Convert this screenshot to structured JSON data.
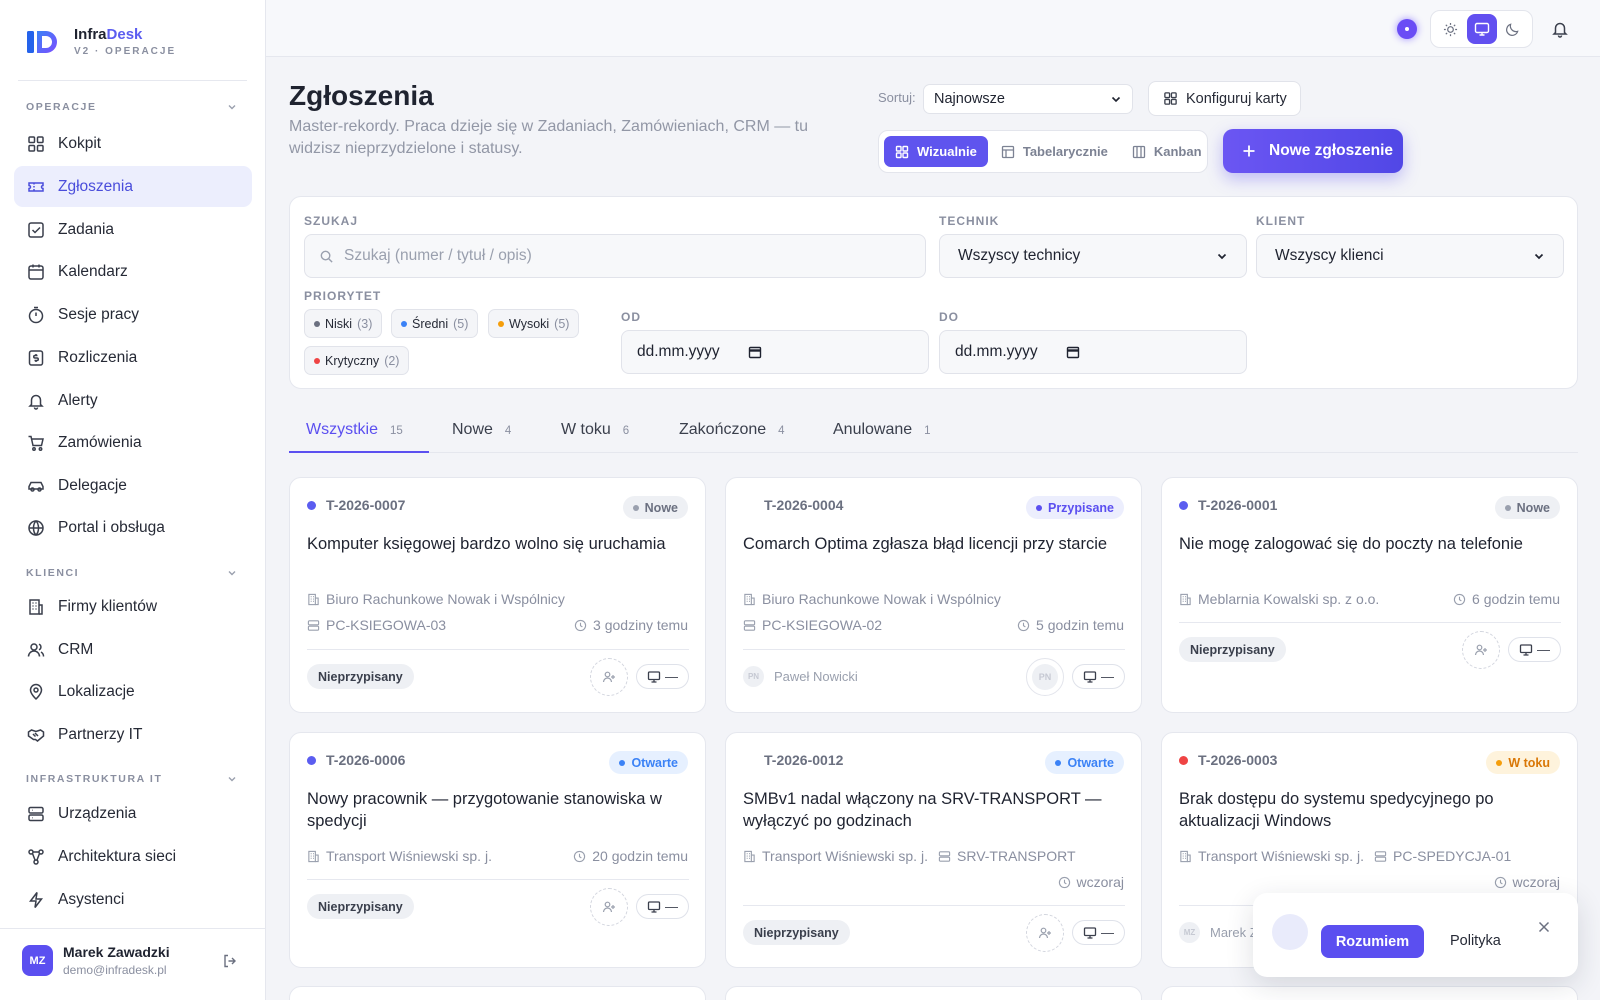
{
  "brand": {
    "name_prefix": "Infra",
    "name_accent": "Desk",
    "subtitle": "V2 · OPERACJE"
  },
  "sidebar": {
    "sections": [
      {
        "title": "OPERACJE"
      },
      {
        "title": "KLIENCI"
      },
      {
        "title": "INFRASTRUKTURA IT"
      }
    ],
    "items": [
      {
        "label": "Kokpit",
        "icon": "grid-icon"
      },
      {
        "label": "Zgłoszenia",
        "icon": "ticket-icon",
        "active": true
      },
      {
        "label": "Zadania",
        "icon": "checkbox-icon"
      },
      {
        "label": "Kalendarz",
        "icon": "calendar-icon"
      },
      {
        "label": "Sesje pracy",
        "icon": "stopwatch-icon"
      },
      {
        "label": "Rozliczenia",
        "icon": "receipt-icon"
      },
      {
        "label": "Alerty",
        "icon": "bell-icon"
      },
      {
        "label": "Zamówienia",
        "icon": "cart-icon"
      },
      {
        "label": "Delegacje",
        "icon": "car-icon"
      },
      {
        "label": "Portal i obsługa",
        "icon": "globe-icon"
      },
      {
        "label": "Firmy klientów",
        "icon": "building-icon"
      },
      {
        "label": "CRM",
        "icon": "users-icon"
      },
      {
        "label": "Lokalizacje",
        "icon": "pin-icon"
      },
      {
        "label": "Partnerzy IT",
        "icon": "handshake-icon"
      },
      {
        "label": "Urządzenia",
        "icon": "server-icon"
      },
      {
        "label": "Architektura sieci",
        "icon": "network-icon"
      },
      {
        "label": "Asystenci",
        "icon": "bolt-icon"
      }
    ]
  },
  "user": {
    "initials": "MZ",
    "name": "Marek Zawadzki",
    "email": "demo@infradesk.pl"
  },
  "header": {
    "title": "Zgłoszenia",
    "subtitle": "Master-rekordy. Praca dzieje się w Zadaniach, Zamówieniach, CRM — tu widzisz nieprzydzielone i statusy.",
    "sort_label": "Sortuj:",
    "sort_value": "Najnowsze",
    "config_label": "Konfiguruj karty",
    "views": [
      "Wizualnie",
      "Tabelarycznie",
      "Kanban"
    ],
    "new_label": "Nowe zgłoszenie"
  },
  "filters": {
    "search_label": "SZUKAJ",
    "search_placeholder": "Szukaj (numer / tytuł / opis)",
    "tech_label": "TECHNIK",
    "tech_value": "Wszyscy technicy",
    "client_label": "KLIENT",
    "client_value": "Wszyscy klienci",
    "priority_label": "PRIORYTET",
    "priorities": [
      {
        "label": "Niski",
        "count": "(3)",
        "color": "#6b7080"
      },
      {
        "label": "Średni",
        "count": "(5)",
        "color": "#3b82f6"
      },
      {
        "label": "Wysoki",
        "count": "(5)",
        "color": "#f59e0b"
      },
      {
        "label": "Krytyczny",
        "count": "(2)",
        "color": "#ef4444"
      }
    ],
    "from_label": "OD",
    "to_label": "DO",
    "date_placeholder": "dd.mm.yyyy"
  },
  "tabs": [
    {
      "label": "Wszystkie",
      "count": "15"
    },
    {
      "label": "Nowe",
      "count": "4"
    },
    {
      "label": "W toku",
      "count": "6"
    },
    {
      "label": "Zakończone",
      "count": "4"
    },
    {
      "label": "Anulowane",
      "count": "1"
    }
  ],
  "cards": [
    {
      "id": "T-2026-0007",
      "dot": "#5b5df0",
      "status": "Nowe",
      "title": "Komputer księgowej bardzo wolno się uruchamia",
      "client": "Biuro Rachunkowe Nowak i Wspólnicy",
      "device": "PC-KSIEGOWA-03",
      "time": "3 godziny temu",
      "assignee": "Nieprzypisany",
      "device_btn": "—"
    },
    {
      "id": "T-2026-0004",
      "dot": "",
      "status": "Przypisane",
      "title": "Comarch Optima zgłasza błąd licencji przy starcie",
      "client": "Biuro Rachunkowe Nowak i Wspólnicy",
      "device": "PC-KSIEGOWA-02",
      "time": "5 godzin temu",
      "assignee": "Paweł Nowicki",
      "assignee_initials": "PN",
      "device_btn": "—"
    },
    {
      "id": "T-2026-0001",
      "dot": "#5b5df0",
      "status": "Nowe",
      "title": "Nie mogę zalogować się do poczty na telefonie",
      "client": "Meblarnia Kowalski sp. z o.o.",
      "time": "6 godzin temu",
      "assignee": "Nieprzypisany",
      "device_btn": "—"
    },
    {
      "id": "T-2026-0006",
      "dot": "#5b5df0",
      "status": "Otwarte",
      "title": "Nowy pracownik — przygotowanie stanowiska w spedycji",
      "client": "Transport Wiśniewski sp. j.",
      "time": "20 godzin temu",
      "assignee": "Nieprzypisany",
      "device_btn": "—"
    },
    {
      "id": "T-2026-0012",
      "dot": "",
      "status": "Otwarte",
      "title": "SMBv1 nadal włączony na SRV-TRANSPORT — wyłączyć po godzinach",
      "client": "Transport Wiśniewski sp. j.",
      "device": "SRV-TRANSPORT",
      "time": "wczoraj",
      "assignee": "Nieprzypisany",
      "device_btn": "—"
    },
    {
      "id": "T-2026-0003",
      "dot": "#ef4444",
      "status": "W toku",
      "title": "Brak dostępu do systemu spedycyjnego po aktualizacji Windows",
      "client": "Transport Wiśniewski sp. j.",
      "device": "PC-SPEDYCJA-01",
      "time": "wczoraj",
      "assignee": "Marek Z",
      "assignee_initials": "MZ"
    }
  ],
  "cookie": {
    "accept": "Rozumiem",
    "policy": "Polityka"
  },
  "colors": {
    "accent": "#5b4ff0",
    "badge_new": "#6b7080",
    "badge_assigned": "#5b4ff0",
    "badge_open": "#3b82f6",
    "badge_progress": "#d97706"
  }
}
